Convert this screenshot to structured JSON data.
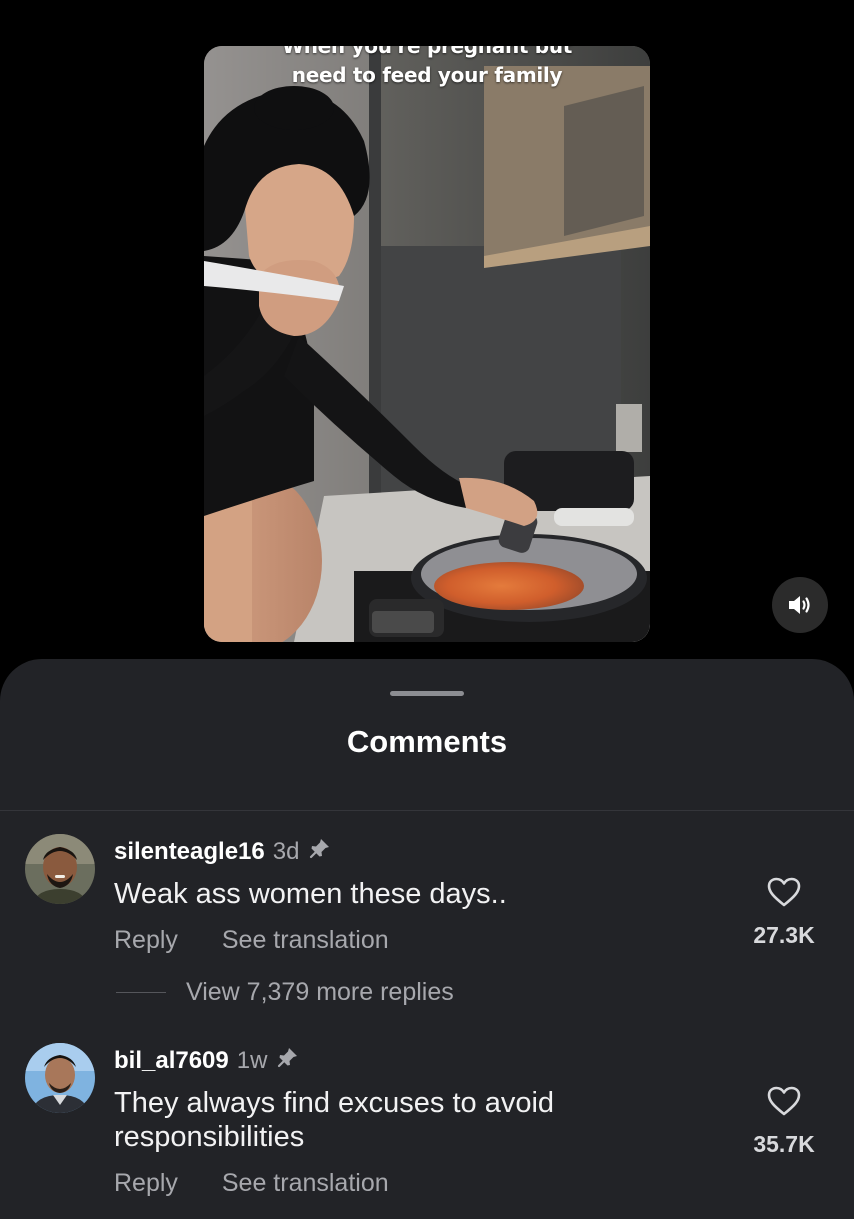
{
  "video": {
    "caption_line1": "When you're pregnant but",
    "caption_line2": "need to feed your family",
    "sound_icon": "speaker-sound-on-icon"
  },
  "comments_sheet": {
    "title": "Comments",
    "comments": [
      {
        "username": "silenteagle16",
        "time": "3d",
        "pinned": true,
        "text": "Weak ass women these days..",
        "reply_label": "Reply",
        "translate_label": "See translation",
        "likes": "27.3K",
        "view_replies": "View 7,379 more replies"
      },
      {
        "username": "bil_al7609",
        "time": "1w",
        "pinned": true,
        "text": "They always find excuses to avoid responsibilities",
        "reply_label": "Reply",
        "translate_label": "See translation",
        "likes": "35.7K"
      }
    ]
  },
  "colors": {
    "background": "#000000",
    "sheet": "#222327",
    "secondary_text": "#a7a8ad",
    "primary_text": "#ffffff"
  }
}
